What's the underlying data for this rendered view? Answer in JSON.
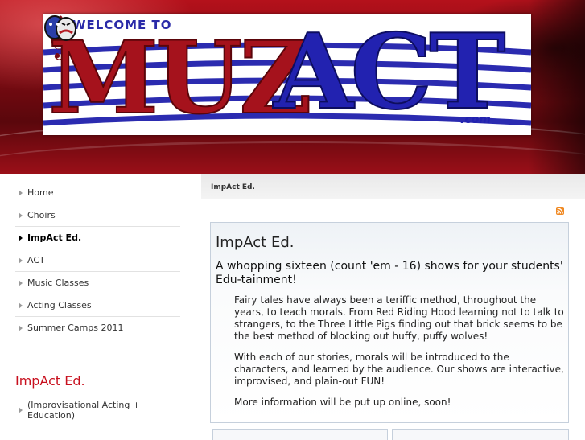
{
  "header": {
    "logo_welcome": "WELCOME TO",
    "logo_word_red": "MUZ",
    "logo_word_blue": "ACT",
    "logo_dotcom": ".com"
  },
  "sidebar": {
    "nav": [
      {
        "label": "Home",
        "active": false
      },
      {
        "label": "Choirs",
        "active": false
      },
      {
        "label": "ImpAct Ed.",
        "active": true
      },
      {
        "label": "ACT",
        "active": false
      },
      {
        "label": "Music Classes",
        "active": false
      },
      {
        "label": "Acting Classes",
        "active": false
      },
      {
        "label": "Summer Camps 2011",
        "active": false
      }
    ],
    "section_heading": "ImpAct Ed.",
    "sub_nav": [
      {
        "label": "(Improvisational Acting + Education)"
      }
    ]
  },
  "main": {
    "breadcrumb": "ImpAct Ed.",
    "rss_icon": "rss-feed-icon",
    "title": "ImpAct Ed.",
    "subtitle": "A whopping sixteen (count 'em - 16) shows for your students' Edu-tainment!",
    "paragraphs": [
      "Fairy tales have always been a teriffic method, throughout the years, to teach morals. From Red Riding Hood learning not to talk to strangers, to the Three Little Pigs finding out that brick seems to be the best method of blocking out huffy, puffy wolves!",
      "With each of our stories, morals will be introduced to the characters, and learned by the audience. Our shows are interactive, improvised, and plain-out FUN!",
      "More information will be put up online, soon!"
    ]
  },
  "colors": {
    "header_red": "#9a0f18",
    "heading_red": "#c8101e",
    "logo_red": "#a5121c",
    "logo_blue": "#2222b0",
    "rss_orange": "#f08a24",
    "box_border": "#c6d0dc"
  }
}
